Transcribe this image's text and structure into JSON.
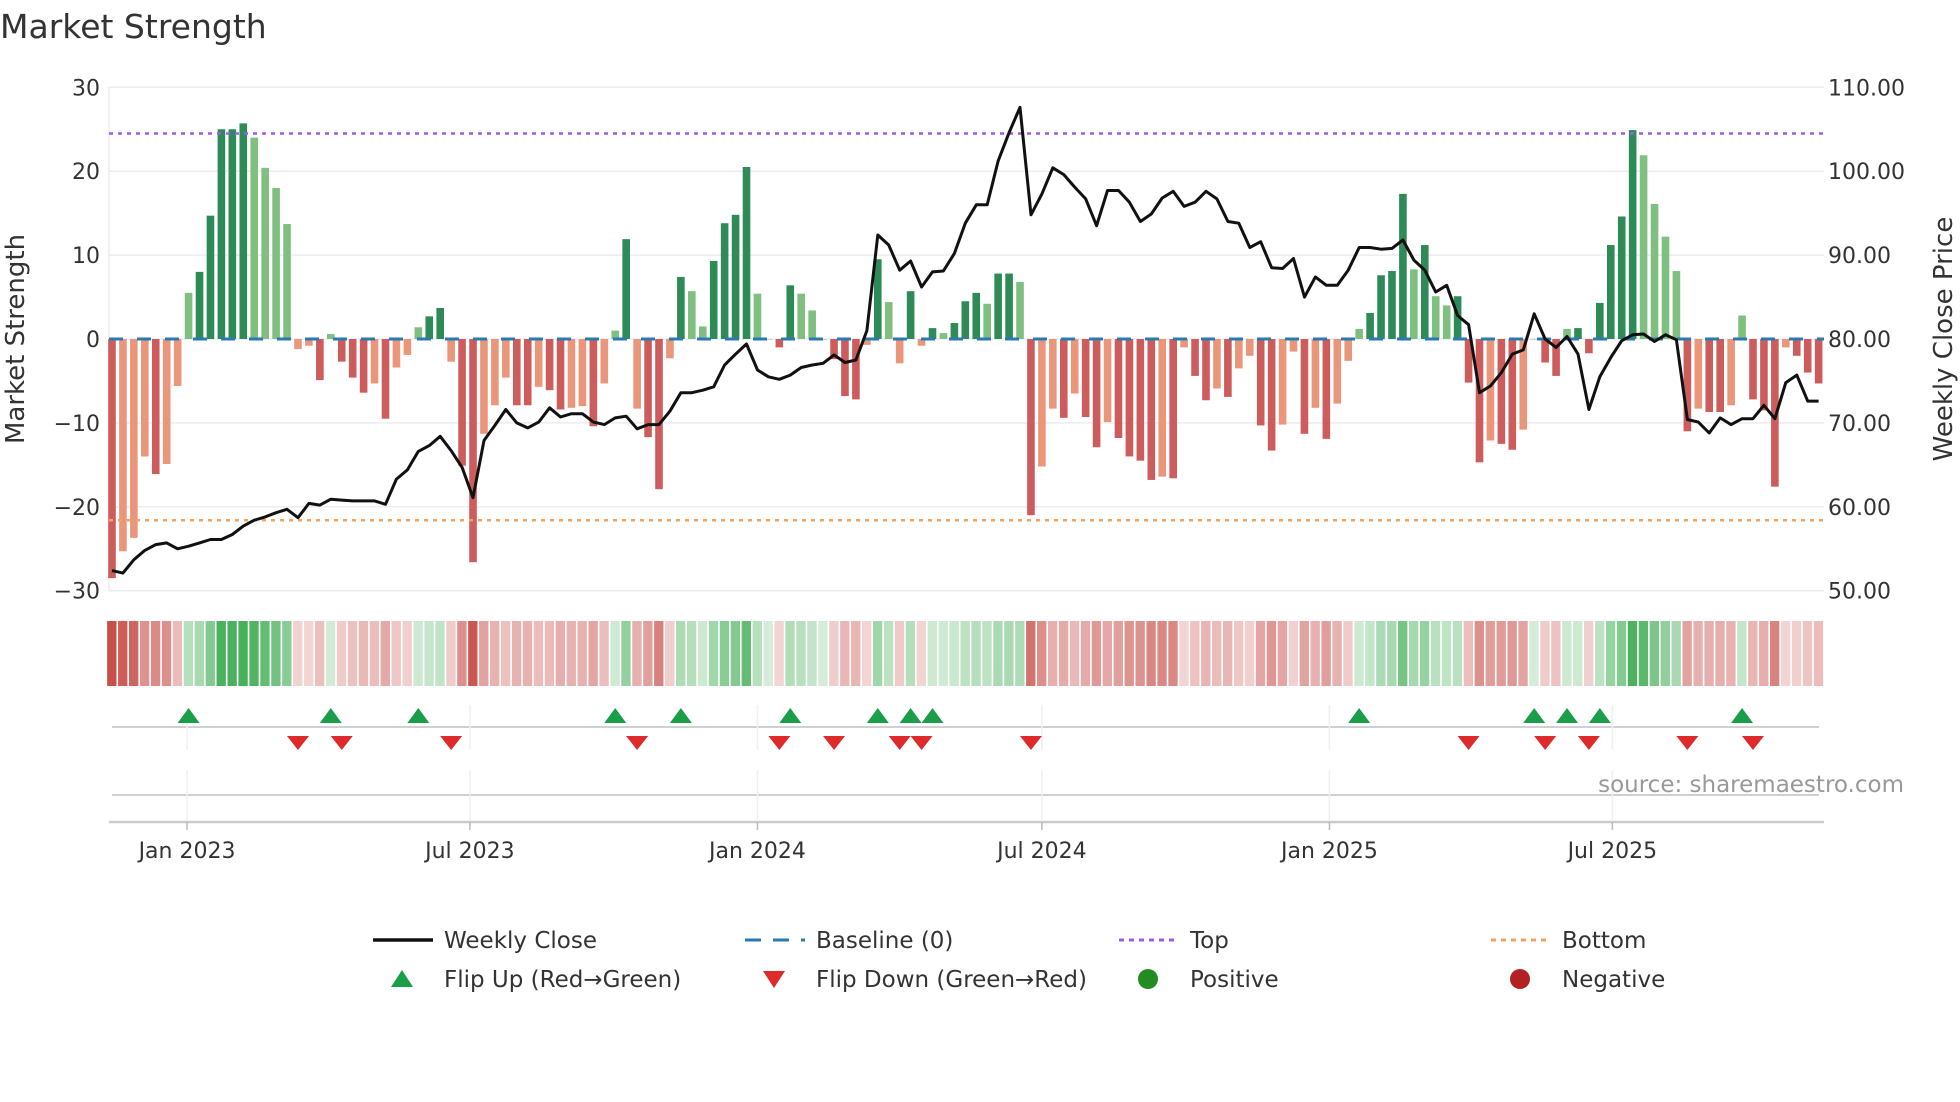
{
  "chart_data": {
    "type": "bar",
    "title": "Market Strength",
    "ylabel": "Market Strength",
    "y2label": "Weekly Close Price",
    "ylim": [
      -30,
      30
    ],
    "y2lim": [
      50,
      110
    ],
    "yticks": [
      "30",
      "20",
      "10",
      "0",
      "−10",
      "−20",
      "−30"
    ],
    "ytick_values": [
      30,
      20,
      10,
      0,
      -10,
      -20,
      -30
    ],
    "y2ticks": [
      "110.00",
      "100.00",
      "90.00",
      "80.00",
      "70.00",
      "60.00",
      "50.00"
    ],
    "y2tick_values": [
      110,
      100,
      90,
      80,
      70,
      60,
      50
    ],
    "x_start": "2022-11-14",
    "x_step_days": 7,
    "xticks": [
      {
        "label": "Jan 2023",
        "date": "2023-01-01"
      },
      {
        "label": "Jul 2023",
        "date": "2023-07-01"
      },
      {
        "label": "Jan 2024",
        "date": "2024-01-01"
      },
      {
        "label": "Jul 2024",
        "date": "2024-07-01"
      },
      {
        "label": "Jan 2025",
        "date": "2025-01-01"
      },
      {
        "label": "Jul 2025",
        "date": "2025-07-01"
      }
    ],
    "top_level": 24.5,
    "bottom_level": -21.6,
    "baseline": 0,
    "strength": [
      -28.5,
      -25.3,
      -23.7,
      -14,
      -16.1,
      -14.9,
      -5.6,
      5.5,
      8,
      14.7,
      25,
      25,
      25.7,
      24,
      20.4,
      18,
      13.7,
      -1.2,
      -0.8,
      -4.9,
      0.6,
      -2.7,
      -4.6,
      -6.4,
      -5.3,
      -9.5,
      -3.4,
      -1.9,
      1.4,
      2.7,
      3.7,
      -2.7,
      -15.1,
      -26.6,
      -11.3,
      -7.9,
      -4.6,
      -7.9,
      -7.9,
      -5.7,
      -6.1,
      -8.4,
      -8.2,
      -8.0,
      -10.4,
      -5.3,
      1,
      11.9,
      -8.3,
      -11.7,
      -17.9,
      -2.3,
      7.4,
      5.7,
      1.5,
      9.3,
      13.8,
      14.8,
      20.5,
      5.4,
      0,
      -1,
      6.4,
      5.4,
      3.4,
      0,
      -2.4,
      -6.8,
      -7.2,
      -0.7,
      9.5,
      4.4,
      -2.9,
      5.7,
      -0.8,
      1.3,
      0.7,
      1.9,
      4.5,
      5.5,
      4.2,
      7.8,
      7.8,
      6.8,
      -21,
      -15.2,
      -8.3,
      -9.4,
      -6.5,
      -9.3,
      -12.9,
      -9.9,
      -11.8,
      -14,
      -14.5,
      -16.8,
      -16.4,
      -16.6,
      -1,
      -4.4,
      -7.3,
      -5.9,
      -6.9,
      -3.5,
      -2,
      -10.3,
      -13.3,
      -10.2,
      -1.5,
      -11.3,
      -8.2,
      -11.9,
      -7.7,
      -2.6,
      1.2,
      3.1,
      7.6,
      8.1,
      17.3,
      8.3,
      11.2,
      5.1,
      4,
      5.1,
      -5.2,
      -14.7,
      -12.1,
      -12.5,
      -13.2,
      -10.8,
      0,
      -2.8,
      -4.4,
      1.2,
      1.3,
      -1.7,
      4.3,
      11.2,
      14.6,
      24.9,
      21.9,
      16.1,
      12.2,
      8.1,
      -11,
      -8.3,
      -8.7,
      -8.7,
      -7.9,
      2.8,
      -7.2,
      -8.5,
      -17.6,
      -1,
      -2,
      -4,
      -5.3
    ],
    "weekly_close": [
      52.4,
      52.1,
      53.7,
      54.8,
      55.5,
      55.7,
      55.0,
      55.3,
      55.7,
      56.1,
      56.1,
      56.7,
      57.7,
      58.4,
      58.8,
      59.3,
      59.7,
      58.7,
      60.4,
      60.2,
      60.9,
      60.8,
      60.7,
      60.7,
      60.7,
      60.3,
      63.3,
      64.4,
      66.6,
      67.3,
      68.4,
      66.7,
      64.7,
      61.1,
      67.9,
      69.7,
      71.6,
      70.0,
      69.4,
      70.1,
      71.8,
      70.7,
      71.1,
      71.1,
      70.1,
      69.8,
      70.6,
      70.8,
      69.3,
      69.8,
      69.8,
      71.4,
      73.6,
      73.6,
      73.9,
      74.3,
      76.9,
      78.2,
      79.4,
      76.3,
      75.5,
      75.2,
      75.7,
      76.6,
      76.9,
      77.1,
      78.1,
      77.2,
      77.5,
      81.0,
      92.4,
      91.2,
      88.2,
      89.3,
      86.2,
      88.0,
      88.1,
      90.2,
      93.8,
      96.0,
      96.0,
      101.2,
      104.6,
      107.6,
      94.8,
      97.3,
      100.4,
      99.6,
      98.1,
      96.7,
      93.5,
      97.7,
      97.7,
      96.3,
      94.0,
      94.9,
      96.8,
      97.6,
      95.8,
      96.3,
      97.6,
      96.7,
      94.0,
      93.8,
      90.9,
      91.6,
      88.5,
      88.4,
      89.6,
      85.0,
      87.4,
      86.4,
      86.4,
      88.2,
      90.9,
      90.9,
      90.7,
      90.8,
      91.8,
      89.4,
      88.2,
      85.6,
      86.4,
      82.8,
      81.7,
      73.6,
      74.4,
      76.0,
      78.2,
      78.7,
      83.0,
      80.0,
      79.0,
      80.3,
      78.2,
      71.6,
      75.5,
      77.8,
      79.8,
      80.5,
      80.6,
      79.7,
      80.5,
      79.9,
      70.4,
      70.1,
      68.8,
      70.6,
      69.8,
      70.5,
      70.5,
      72.1,
      70.5,
      74.8,
      75.7,
      72.6,
      72.6
    ],
    "flip_up_weeks": [
      7,
      20,
      28,
      46,
      52,
      62,
      70,
      73,
      75,
      114,
      130,
      133,
      136,
      149
    ],
    "flip_down_weeks": [
      17,
      21,
      31,
      48,
      61,
      66,
      72,
      74,
      84,
      124,
      131,
      135,
      144,
      150
    ],
    "legend": [
      {
        "label": "Weekly Close",
        "symbol": "line",
        "color": "#111111"
      },
      {
        "label": "Baseline (0)",
        "symbol": "dash",
        "color": "#2a7ab0"
      },
      {
        "label": "Top",
        "symbol": "dot",
        "color": "#9b5de5"
      },
      {
        "label": "Bottom",
        "symbol": "dot",
        "color": "#f4a261"
      },
      {
        "label": "Flip Up (Red→Green)",
        "symbol": "triangle-up",
        "color": "#1a9e4a"
      },
      {
        "label": "Flip Down (Green→Red)",
        "symbol": "triangle-down",
        "color": "#dd2a2a"
      },
      {
        "label": "Positive",
        "symbol": "circle",
        "color": "#228b22"
      },
      {
        "label": "Negative",
        "symbol": "circle",
        "color": "#b22222"
      }
    ],
    "legend_position": "bottom",
    "colors": {
      "pos_dark": "#2e8b57",
      "pos_light": "#7fbf7f",
      "neg_dark": "#cd5c5c",
      "neg_light": "#e9967a"
    },
    "source": "source: sharemaestro.com"
  }
}
